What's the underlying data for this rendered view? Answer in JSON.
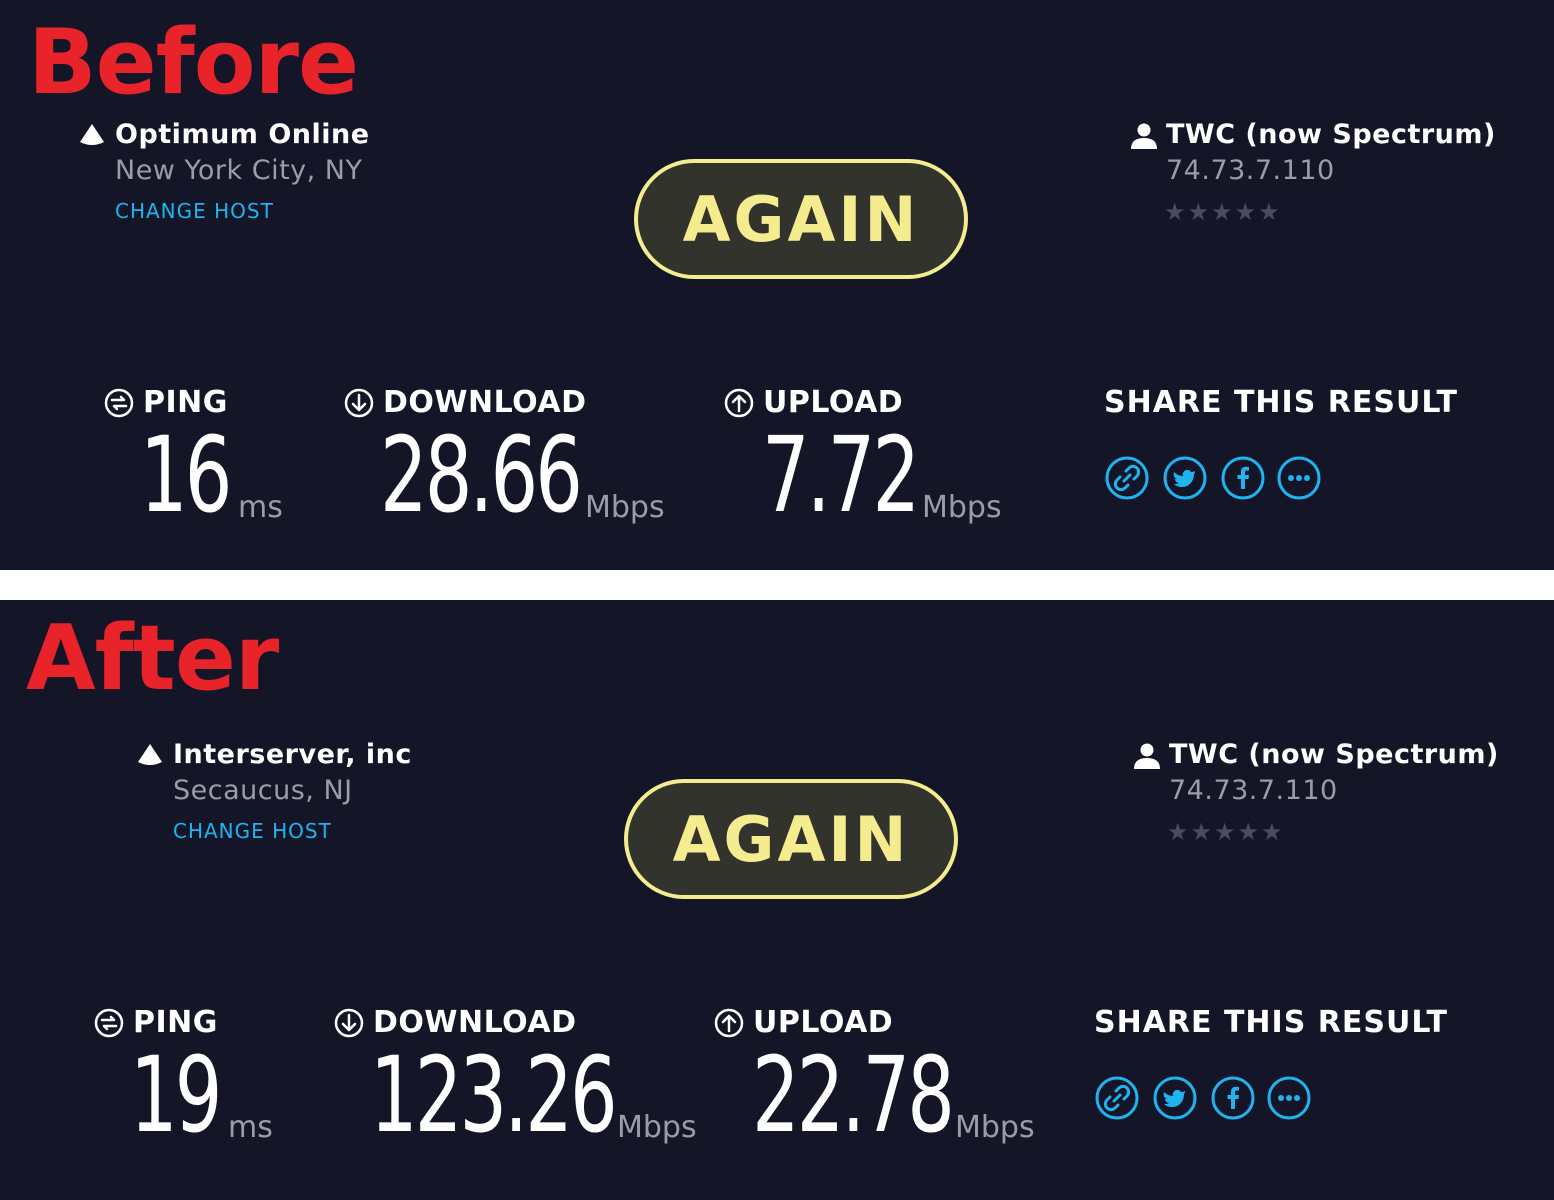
{
  "theme": {
    "background": "#141628",
    "accent": "#1fb3f0",
    "button": "#f4ec8f",
    "label_red": "#e8232a"
  },
  "before": {
    "tag": "Before",
    "host": {
      "name": "Optimum Online",
      "location": "New York City, NY",
      "change_label": "CHANGE HOST",
      "icon": "host-marker-icon"
    },
    "again_label": "AGAIN",
    "isp": {
      "name": "TWC (now Spectrum)",
      "ip": "74.73.7.110",
      "stars": "★★★★★",
      "rating": 0,
      "icon": "user-icon"
    },
    "metrics": {
      "ping": {
        "label": "PING",
        "value": "16",
        "unit": "ms"
      },
      "download": {
        "label": "DOWNLOAD",
        "value": "28.66",
        "unit": "Mbps"
      },
      "upload": {
        "label": "UPLOAD",
        "value": "7.72",
        "unit": "Mbps"
      }
    },
    "share": {
      "title": "SHARE THIS RESULT",
      "buttons": [
        "link-icon",
        "twitter-icon",
        "facebook-icon",
        "more-icon"
      ]
    }
  },
  "after": {
    "tag": "After",
    "host": {
      "name": "Interserver, inc",
      "location": "Secaucus, NJ",
      "change_label": "CHANGE HOST",
      "icon": "host-marker-icon"
    },
    "again_label": "AGAIN",
    "isp": {
      "name": "TWC (now Spectrum)",
      "ip": "74.73.7.110",
      "stars": "★★★★★",
      "rating": 0,
      "icon": "user-icon"
    },
    "metrics": {
      "ping": {
        "label": "PING",
        "value": "19",
        "unit": "ms"
      },
      "download": {
        "label": "DOWNLOAD",
        "value": "123.26",
        "unit": "Mbps"
      },
      "upload": {
        "label": "UPLOAD",
        "value": "22.78",
        "unit": "Mbps"
      }
    },
    "share": {
      "title": "SHARE THIS RESULT",
      "buttons": [
        "link-icon",
        "twitter-icon",
        "facebook-icon",
        "more-icon"
      ]
    }
  }
}
